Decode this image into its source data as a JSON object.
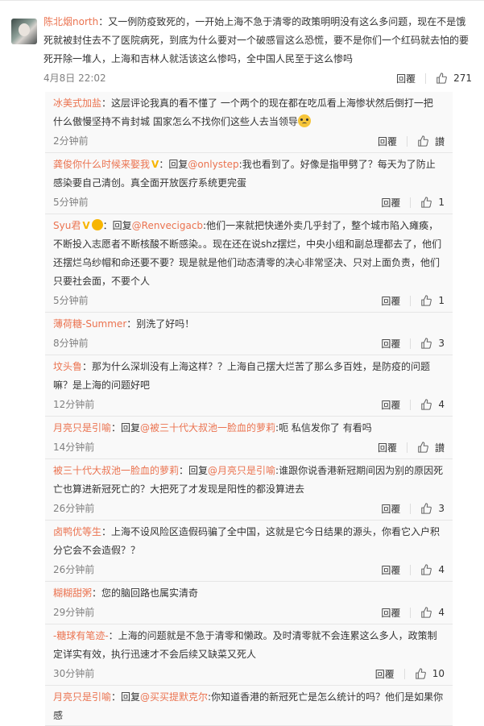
{
  "main": {
    "user": "陈北烟north",
    "text": "：又一例防疫致死的，一开始上海不急于清零的政策明明没有这么多问题，现在不是饿死就被封住去不了医院病死，到底为什么要对一个破感冒这么恐慌，要不是你们一个红码就去怕的要死开除一堆人，上海和吉林人就活该这么惨吗，全中国人民至于这么惨吗",
    "time": "4月8日 22:02",
    "reply_label": "回覆",
    "likes": "271"
  },
  "replies": [
    {
      "user": "冰美式加盐",
      "parts": [
        {
          "type": "text",
          "value": "：这层评论我真的看不懂了 一个两个的现在都在吃瓜看上海惨状然后倒打一把 什么傲慢坚持不肯封城 国家怎么不找你们这些人去当领导"
        },
        {
          "type": "emoji",
          "value": "blush"
        }
      ],
      "time": "2分钟前",
      "reply_label": "回覆",
      "likes": "讃"
    },
    {
      "user": "龚俊你什么时候来娶我",
      "badge": "V",
      "parts": [
        {
          "type": "text",
          "value": "：回复"
        },
        {
          "type": "mention",
          "value": "@onlystep"
        },
        {
          "type": "text",
          "value": ":我也看到了。好像是指甲劈了？每天为了防止感染要自己清创。真全面开放医疗系统更完蛋"
        }
      ],
      "time": "5分钟前",
      "reply_label": "回覆",
      "likes": "1"
    },
    {
      "user": "Syu君",
      "badge": "V",
      "badge2": true,
      "parts": [
        {
          "type": "text",
          "value": "：回复"
        },
        {
          "type": "mention",
          "value": "@Renvecigacb"
        },
        {
          "type": "text",
          "value": ":他们一来就把快递外卖几乎封了，整个城市陷入瘫痪，不断投入志愿者不断核酸不断感染。。现在还在说shz摆烂，中央小组和副总理都去了，他们还摆烂乌纱帽和命还要不要？现是就是他们动态清零的决心非常坚决、只对上面负责，他们只要社会面，不要个人"
        }
      ],
      "time": "5分钟前",
      "reply_label": "回覆",
      "likes": "1"
    },
    {
      "user": "薄荷糖-Summer",
      "parts": [
        {
          "type": "text",
          "value": "：别洗了好吗！"
        }
      ],
      "time": "8分钟前",
      "reply_label": "回覆",
      "likes": "3"
    },
    {
      "user": "坟头鲁",
      "parts": [
        {
          "type": "text",
          "value": "：那为什么深圳没有上海这样？？上海自己摆大烂苦了那么多百姓，是防疫的问题嘛？是上海的问题好吧"
        }
      ],
      "time": "12分钟前",
      "reply_label": "回覆",
      "likes": "4"
    },
    {
      "user": "月亮只是引喻",
      "parts": [
        {
          "type": "text",
          "value": "：回复"
        },
        {
          "type": "mention",
          "value": "@被三十代大叔池一脸血的萝莉"
        },
        {
          "type": "text",
          "value": ":呃 私信发你了 有看吗"
        }
      ],
      "time": "14分钟前",
      "reply_label": "回覆",
      "likes": "讃"
    },
    {
      "user": "被三十代大叔池一脸血的萝莉",
      "parts": [
        {
          "type": "text",
          "value": "：回复"
        },
        {
          "type": "mention",
          "value": "@月亮只是引喻"
        },
        {
          "type": "text",
          "value": ":谁跟你说香港新冠期间因为别的原因死亡也算进新冠死亡的？大把死了才发现是阳性的都没算进去"
        }
      ],
      "time": "26分钟前",
      "reply_label": "回覆",
      "likes": "3"
    },
    {
      "user": "卤鸭优等生",
      "parts": [
        {
          "type": "text",
          "value": "：上海不设风险区造假码骗了全中国，这就是它今日结果的源头，你看它入户积分它会不会造假？？"
        }
      ],
      "time": "26分钟前",
      "reply_label": "回覆",
      "likes": "4"
    },
    {
      "user": "糊糊甜粥",
      "parts": [
        {
          "type": "text",
          "value": "：您的脑回路也属实清奇"
        }
      ],
      "time": "29分钟前",
      "reply_label": "回覆",
      "likes": "4"
    },
    {
      "user": "-糖球有笔迹-",
      "parts": [
        {
          "type": "text",
          "value": "：上海的问题就是不急于清零和懒政。及时清零就不会连累这么多人，政策制定详实有效，执行迅速才不会后续又缺菜又死人"
        }
      ],
      "time": "30分钟前",
      "reply_label": "回覆",
      "likes": "10"
    },
    {
      "user": "月亮只是引喻",
      "parts": [
        {
          "type": "text",
          "value": "：回复"
        },
        {
          "type": "mention",
          "value": "@买买提默克尔"
        },
        {
          "type": "text",
          "value": ":你知道香港的新冠死亡是怎么统计的吗？他们是如果你感"
        }
      ],
      "time": "",
      "reply_label": "",
      "likes": ""
    }
  ],
  "colors": {
    "accent": "#eb7350",
    "time": "#808080",
    "badge": "#f7b500"
  }
}
